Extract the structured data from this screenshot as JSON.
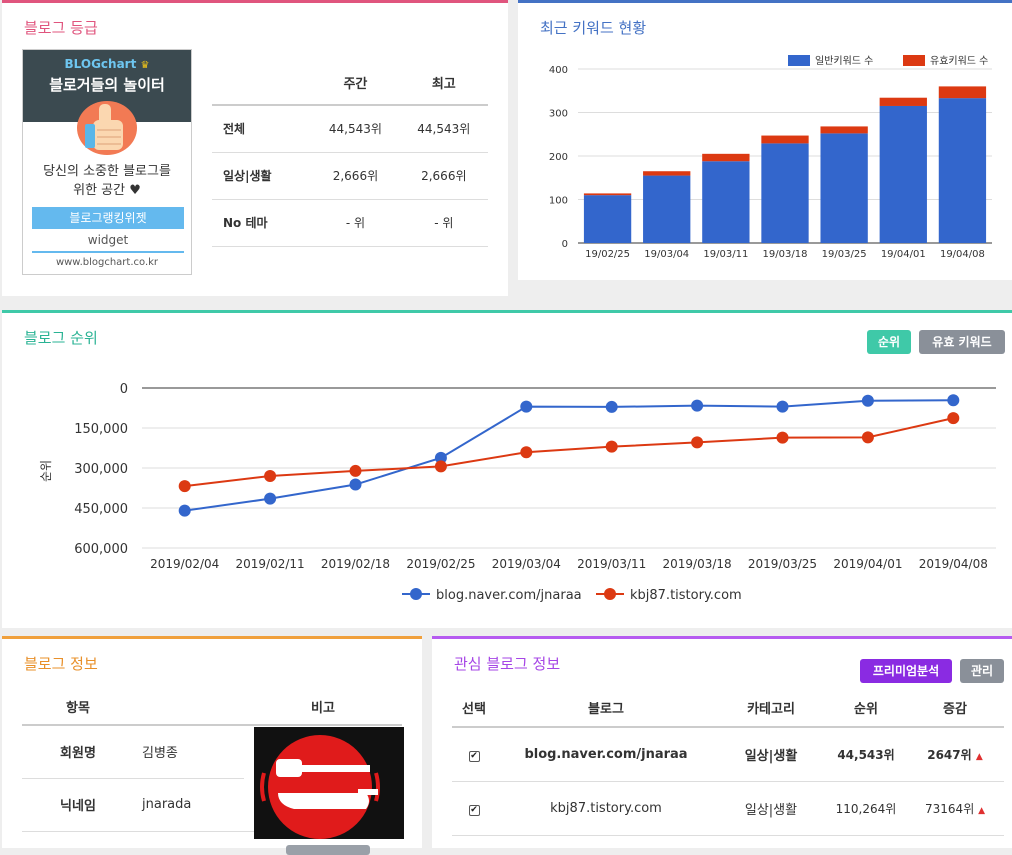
{
  "grade": {
    "title": "블로그 등급",
    "widget": {
      "logo": "BLOGchart",
      "slogan": "블로거들의 놀이터",
      "desc_line1": "당신의 소중한 블로그를",
      "desc_line2": "위한 공간 ♥",
      "button": "블로그랭킹위젯",
      "sub": "widget",
      "url": "www.blogchart.co.kr"
    },
    "table": {
      "headers": [
        "",
        "주간",
        "최고"
      ],
      "rows": [
        {
          "label": "전체",
          "weekly": "44,543위",
          "best": "44,543위"
        },
        {
          "label": "일상|생활",
          "weekly": "2,666위",
          "best": "2,666위"
        },
        {
          "label": "No 테마",
          "weekly": "- 위",
          "best": "- 위"
        }
      ]
    }
  },
  "keywords": {
    "title": "최근 키워드 현황",
    "chart_data": {
      "type": "bar",
      "stacked": true,
      "categories": [
        "19/02/25",
        "19/03/04",
        "19/03/11",
        "19/03/18",
        "19/03/25",
        "19/04/01",
        "19/04/08"
      ],
      "series": [
        {
          "name": "일반키워드 수",
          "color": "#3366cc",
          "values": [
            110,
            155,
            188,
            229,
            252,
            315,
            333
          ]
        },
        {
          "name": "유효키워드 수",
          "color": "#dc3912",
          "values": [
            4,
            10,
            17,
            18,
            16,
            19,
            27
          ]
        }
      ],
      "ylim": [
        0,
        400
      ],
      "yticks": [
        0,
        100,
        200,
        300,
        400
      ],
      "legend": "top-right",
      "grid": true
    }
  },
  "rank": {
    "title": "블로그 순위",
    "btn_rank": "순위",
    "btn_keyword": "유효 키워드",
    "chart_data": {
      "type": "line",
      "x": [
        "2019/02/04",
        "2019/02/11",
        "2019/02/18",
        "2019/02/25",
        "2019/03/04",
        "2019/03/11",
        "2019/03/18",
        "2019/03/25",
        "2019/04/01",
        "2019/04/08"
      ],
      "ylabel": "순위",
      "ylim": [
        0,
        600000
      ],
      "y_reversed": true,
      "yticks": [
        "0",
        "150,000",
        "300,000",
        "450,000",
        "600,000"
      ],
      "series": [
        {
          "name": "blog.naver.com/jnaraa",
          "color": "#3366cc",
          "values": [
            460000,
            415000,
            362000,
            262000,
            70000,
            71000,
            66000,
            70000,
            48000,
            46000
          ]
        },
        {
          "name": "kbj87.tistory.com",
          "color": "#dc3912",
          "values": [
            368000,
            330000,
            311000,
            294000,
            241000,
            220000,
            204000,
            186000,
            185000,
            113000
          ]
        }
      ],
      "legend": "bottom",
      "grid": true
    }
  },
  "info": {
    "title": "블로그 정보",
    "headers": [
      "항목",
      "",
      "비고"
    ],
    "rows": [
      {
        "label": "회원명",
        "value": "김병종"
      },
      {
        "label": "닉네임",
        "value": "jnarada"
      }
    ]
  },
  "interest": {
    "title": "관심 블로그 정보",
    "btn_premium": "프리미엄분석",
    "btn_manage": "관리",
    "headers": [
      "선택",
      "블로그",
      "카테고리",
      "순위",
      "증감"
    ],
    "rows": [
      {
        "checked": "✔",
        "blog": "blog.naver.com/jnaraa",
        "category": "일상|생활",
        "rank": "44,543위",
        "change": "2647위",
        "bold": true
      },
      {
        "checked": "✔",
        "blog": "kbj87.tistory.com",
        "category": "일상|생활",
        "rank": "110,264위",
        "change": "73164위",
        "bold": false
      }
    ]
  }
}
